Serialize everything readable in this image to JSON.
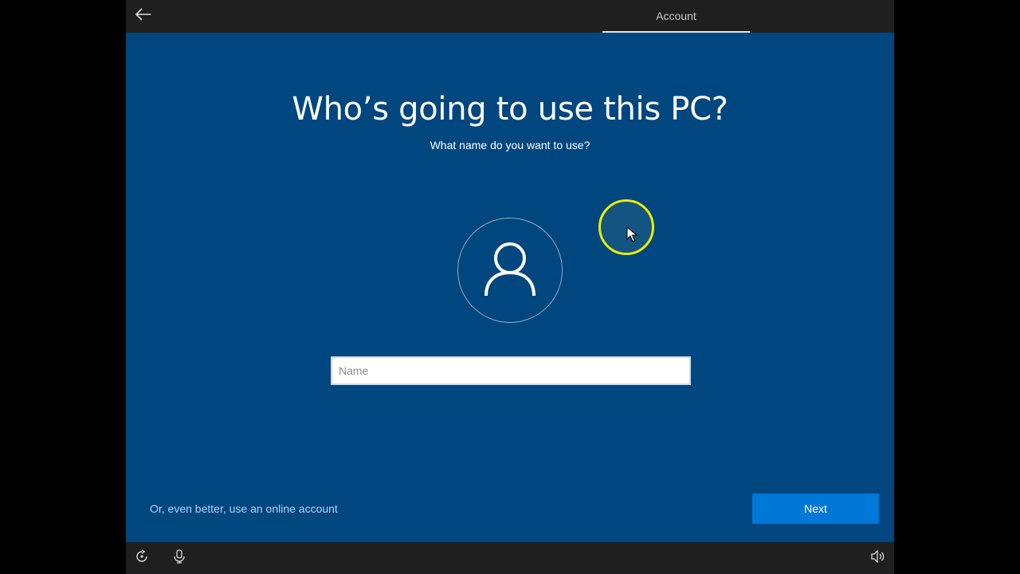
{
  "window": {
    "background": "#00467f"
  },
  "topbar": {
    "back_icon": "back-arrow-icon",
    "active_tab": "Account"
  },
  "main": {
    "title": "Who’s going to use this PC?",
    "subtitle": "What name do you want to use?",
    "avatar_icon": "user-icon",
    "name_input": {
      "placeholder": "Name",
      "value": ""
    }
  },
  "footer": {
    "online_account_link": "Or, even better, use an online account",
    "next_label": "Next"
  },
  "bottombar": {
    "icons": [
      "ease-of-access-icon",
      "microphone-icon",
      "volume-icon"
    ]
  },
  "colors": {
    "accent": "#0078d7",
    "link": "#a8d4ff",
    "bar": "#1f1f1f",
    "cursor_highlight": "#e8f000"
  }
}
